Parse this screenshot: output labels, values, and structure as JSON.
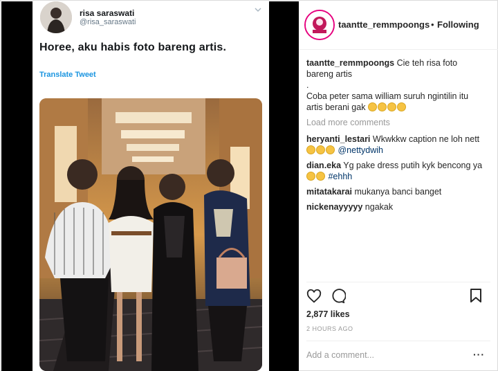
{
  "tweet": {
    "name": "risa saraswati",
    "handle": "@risa_saraswati",
    "text": "Horee, aku habis foto bareng artis.",
    "translate": "Translate Tweet"
  },
  "post": {
    "username": "taantte_remmpoongs",
    "dot": "•",
    "follow_state": "Following",
    "caption_user": "taantte_remmpoongs",
    "caption_line1": "Cie teh risa foto bareng artis",
    "caption_line2": ".",
    "caption_line3": "Coba peter sama william suruh ngintilin itu artis berani gak",
    "load_more": "Load more comments",
    "comments": [
      {
        "user": "heryanti_lestari",
        "text": "Wkwkkw caption ne loh nett",
        "mention": "@nettydwih"
      },
      {
        "user": "dian.eka",
        "text": "Yg pake dress putih kyk bencong ya",
        "mention": "#ehhh"
      },
      {
        "user": "mitatakarai",
        "text": "mukanya banci banget"
      },
      {
        "user": "nickenayyyyy",
        "text": "ngakak"
      }
    ],
    "likes": "2,877 likes",
    "time": "2 HOURS AGO",
    "add_comment": "Add a comment...",
    "more": "···"
  },
  "icons": {
    "like": "heart-icon",
    "comment": "comment-icon",
    "save": "bookmark-icon",
    "chevron": "chevron-down-icon"
  },
  "colors": {
    "link": "#1b95e0",
    "mention": "#003569",
    "ring": "#e6007e"
  }
}
